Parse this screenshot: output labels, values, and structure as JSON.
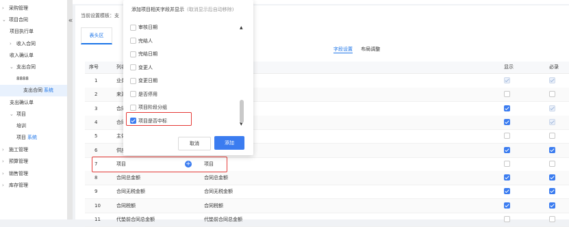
{
  "sidebar": {
    "items": [
      {
        "label": "采购管理",
        "chev": "›",
        "indent": 0
      },
      {
        "label": "项目合同",
        "chev": "⌄",
        "indent": 0
      },
      {
        "label": "项目执行单",
        "chev": "",
        "indent": 1
      },
      {
        "label": "收入合同",
        "chev": "›",
        "indent": 1
      },
      {
        "label": "收入确认单",
        "chev": "",
        "indent": 1
      },
      {
        "label": "支出合同",
        "chev": "⌄",
        "indent": 1
      },
      {
        "label": "8888",
        "chev": "",
        "indent": 2
      },
      {
        "label": "支出合同",
        "chev": "",
        "indent": 2,
        "tag": "系统",
        "active": true
      },
      {
        "label": "支出确认单",
        "chev": "",
        "indent": 1
      },
      {
        "label": "项目",
        "chev": "⌄",
        "indent": 1
      },
      {
        "label": "培训",
        "chev": "",
        "indent": 2
      },
      {
        "label": "项目",
        "chev": "",
        "indent": 2,
        "tag": "系统"
      },
      {
        "label": "施工管理",
        "chev": "›",
        "indent": 0
      },
      {
        "label": "预算管理",
        "chev": "›",
        "indent": 0
      },
      {
        "label": "销售管理",
        "chev": "›",
        "indent": 0
      },
      {
        "label": "库存管理",
        "chev": "›",
        "indent": 0
      }
    ],
    "collapse": "«"
  },
  "breadcrumb": "当前设置模板：支",
  "tab": "表头区",
  "subtabs": [
    "字段设置",
    "布局调整"
  ],
  "table": {
    "headers": {
      "seq": "序号",
      "col": "列名",
      "show": "显示",
      "req": "必录"
    },
    "rows": [
      {
        "seq": "1",
        "name": "业务",
        "label": "",
        "show": "dis",
        "req": "dis"
      },
      {
        "seq": "2",
        "name": "来源",
        "label": "",
        "show": "off",
        "req": "off"
      },
      {
        "seq": "3",
        "name": "合同",
        "label": "",
        "show": "on",
        "req": "dis"
      },
      {
        "seq": "4",
        "name": "合同",
        "label": "",
        "show": "on",
        "req": "dis"
      },
      {
        "seq": "5",
        "name": "主体",
        "label": "",
        "show": "off",
        "req": "off"
      },
      {
        "seq": "6",
        "name": "供应",
        "label": "",
        "show": "on",
        "req": "on"
      },
      {
        "seq": "7",
        "name": "项目",
        "label": "项目",
        "show": "off",
        "req": "off",
        "plus": true
      },
      {
        "seq": "8",
        "name": "合同总金额",
        "label": "合同总金额",
        "show": "on",
        "req": "on"
      },
      {
        "seq": "9",
        "name": "合同无税金额",
        "label": "合同无税金额",
        "show": "on",
        "req": "on"
      },
      {
        "seq": "10",
        "name": "合同税额",
        "label": "合同税额",
        "show": "on",
        "req": "on"
      },
      {
        "seq": "11",
        "name": "代垫前合同总金额",
        "label": "代垫前合同总金额",
        "show": "off",
        "req": "off"
      }
    ]
  },
  "popup": {
    "title": "添加项目相关字段并显示",
    "hint": "(取消显示后自动移除)",
    "items": [
      {
        "label": "审核日期",
        "checked": false
      },
      {
        "label": "完结人",
        "checked": false
      },
      {
        "label": "完结日期",
        "checked": false
      },
      {
        "label": "变更人",
        "checked": false
      },
      {
        "label": "变更日期",
        "checked": false
      },
      {
        "label": "是否停用",
        "checked": false
      },
      {
        "label": "项目阶段分组",
        "checked": false
      },
      {
        "label": "项目是否中标",
        "checked": true
      }
    ],
    "arrow_up": "▲",
    "arrow_down": "▼",
    "cancel": "取消",
    "add": "添加"
  },
  "colors": {
    "accent": "#3b7cf0",
    "highlight": "#e53935",
    "tag": "#1a73e8"
  }
}
